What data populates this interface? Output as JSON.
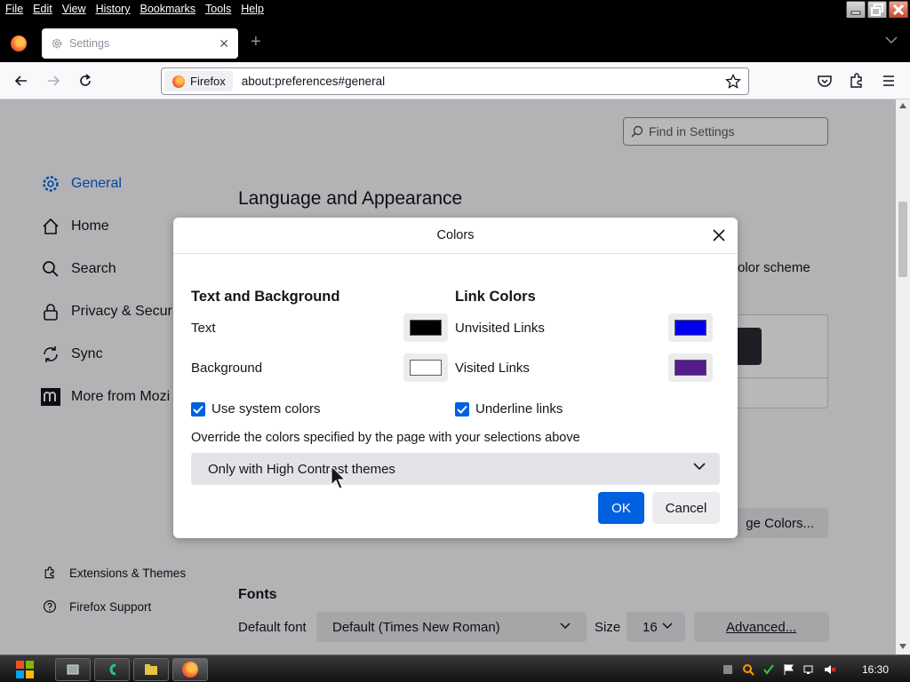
{
  "menu": [
    "File",
    "Edit",
    "View",
    "History",
    "Bookmarks",
    "Tools",
    "Help"
  ],
  "tab": {
    "title": "Settings",
    "close": "✕",
    "new": "+"
  },
  "urlbar": {
    "identity": "Firefox",
    "url": "about:preferences#general"
  },
  "search": {
    "placeholder": "Find in Settings"
  },
  "sidebar": {
    "items": [
      {
        "label": "General",
        "icon": "gear-icon"
      },
      {
        "label": "Home",
        "icon": "home-icon"
      },
      {
        "label": "Search",
        "icon": "search-icon"
      },
      {
        "label": "Privacy & Securi",
        "icon": "lock-icon"
      },
      {
        "label": "Sync",
        "icon": "sync-icon"
      },
      {
        "label": "More from Mozi",
        "icon": "mozilla-icon"
      }
    ],
    "footer": [
      {
        "label": "Extensions & Themes",
        "icon": "puzzle-icon"
      },
      {
        "label": "Firefox Support",
        "icon": "help-icon"
      }
    ]
  },
  "content": {
    "section_title": "Language and Appearance",
    "color_scheme_fragment": "olor scheme",
    "manage_colors_fragment": "ge Colors...",
    "fonts_title": "Fonts",
    "default_font_label": "Default font",
    "default_font_value": "Default (Times New Roman)",
    "size_label": "Size",
    "size_value": "16",
    "advanced_label": "Advanced..."
  },
  "dialog": {
    "title": "Colors",
    "text_bg_heading": "Text and Background",
    "link_heading": "Link Colors",
    "text_label": "Text",
    "background_label": "Background",
    "unvisited_label": "Unvisited Links",
    "visited_label": "Visited Links",
    "use_system_colors": "Use system colors",
    "underline_links": "Underline links",
    "override_label": "Override the colors specified by the page with your selections above",
    "override_value": "Only with High Contrast themes",
    "ok": "OK",
    "cancel": "Cancel",
    "colors": {
      "text": "#000000",
      "background": "#ffffff",
      "unvisited": "#0000ee",
      "visited": "#551a8b"
    }
  },
  "taskbar": {
    "clock": "16:30"
  },
  "accent": "#0061e0"
}
